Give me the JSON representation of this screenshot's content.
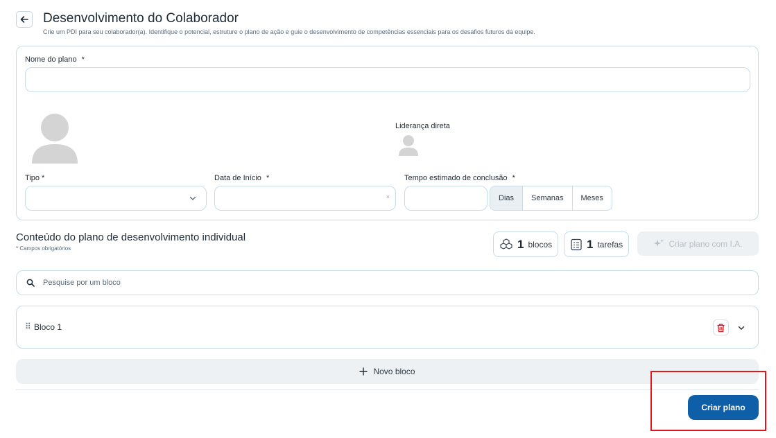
{
  "header": {
    "title": "Desenvolvimento do Colaborador",
    "subtitle": "Crie um PDI para seu colaborador(a). Identifique o potencial, estruture o plano de ação e guie o desenvolvimento de competências essenciais para os desafios futuros da equipe."
  },
  "form": {
    "plan_name_label": "Nome do plano",
    "plan_name_value": "",
    "required_mark": "*",
    "leadership_label": "Liderança direta",
    "type_label": "Tipo *",
    "type_value": "",
    "start_date_label": "Data de Início",
    "start_date_value": "",
    "clear_icon": "×",
    "duration_label": "Tempo estimado de conclusão",
    "duration_value": "",
    "units": [
      "Dias",
      "Semanas",
      "Meses"
    ],
    "selected_unit": "Dias"
  },
  "content": {
    "title": "Conteúdo do plano de desenvolvimento individual",
    "note": "* Campos obrigatórios",
    "blocks_count": "1",
    "blocks_label": "blocos",
    "tasks_count": "1",
    "tasks_label": "tarefas",
    "ai_button": "Criar plano com I.A.",
    "search_placeholder": "Pesquise por um bloco",
    "blocks": [
      {
        "title": "Bloco 1"
      }
    ],
    "drag_handle": "⠿",
    "new_block_label": "Novo bloco"
  },
  "footer": {
    "create_button": "Criar plano"
  },
  "colors": {
    "primary": "#0e5fa8",
    "border": "#c7dcea",
    "danger": "#e4141b",
    "muted_bg": "#eef1f4"
  },
  "icons": [
    "back-arrow-icon",
    "user-avatar-icon",
    "chevron-down-icon",
    "clear-icon",
    "cubes-icon",
    "checklist-icon",
    "sparkles-icon",
    "search-icon",
    "drag-handle-icon",
    "trash-icon",
    "plus-icon"
  ]
}
